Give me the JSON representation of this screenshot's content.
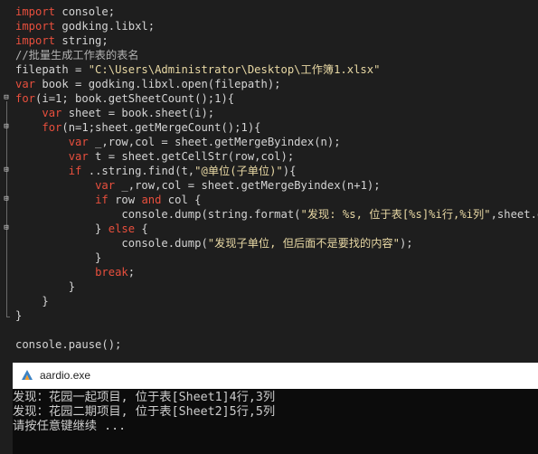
{
  "editor": {
    "lines": [
      [
        {
          "t": "import",
          "c": "kw"
        },
        {
          "t": " console;"
        }
      ],
      [
        {
          "t": "import",
          "c": "kw"
        },
        {
          "t": " godking.libxl;"
        }
      ],
      [
        {
          "t": "import",
          "c": "kw"
        },
        {
          "t": " string;"
        }
      ],
      [
        {
          "t": "//批量生成工作表的表名",
          "c": "cm"
        }
      ],
      [
        {
          "t": "filepath = "
        },
        {
          "t": "\"C:\\Users\\Administrator\\Desktop\\工作簿1.xlsx\"",
          "c": "st"
        }
      ],
      [
        {
          "t": "var",
          "c": "kw"
        },
        {
          "t": " book = godking.libxl.open(filepath);"
        }
      ],
      [
        {
          "t": "for",
          "c": "kw"
        },
        {
          "t": "(i=1; book.getSheetCount();1){"
        }
      ],
      [
        {
          "t": "    "
        },
        {
          "t": "var",
          "c": "kw"
        },
        {
          "t": " sheet = book.sheet(i);"
        }
      ],
      [
        {
          "t": "    "
        },
        {
          "t": "for",
          "c": "kw"
        },
        {
          "t": "(n=1;sheet.getMergeCount();1){"
        }
      ],
      [
        {
          "t": "        "
        },
        {
          "t": "var",
          "c": "kw"
        },
        {
          "t": " _,row,col = sheet.getMergeByindex(n);"
        }
      ],
      [
        {
          "t": "        "
        },
        {
          "t": "var",
          "c": "kw"
        },
        {
          "t": " t = sheet.getCellStr(row,col);"
        }
      ],
      [
        {
          "t": "        "
        },
        {
          "t": "if",
          "c": "kw"
        },
        {
          "t": " ..string.find(t,"
        },
        {
          "t": "\"@单位(子单位)\"",
          "c": "st"
        },
        {
          "t": "){"
        }
      ],
      [
        {
          "t": "            "
        },
        {
          "t": "var",
          "c": "kw"
        },
        {
          "t": " _,row,col = sheet.getMergeByindex(n+1);"
        }
      ],
      [
        {
          "t": "            "
        },
        {
          "t": "if",
          "c": "kw"
        },
        {
          "t": " row "
        },
        {
          "t": "and",
          "c": "kw"
        },
        {
          "t": " col {"
        }
      ],
      [
        {
          "t": "                console.dump(string.format("
        },
        {
          "t": "\"发现: %s, 位于表[%s]%i行,%i列\"",
          "c": "st"
        },
        {
          "t": ",sheet.getCellStr(row,col),sheet.name,row,col));"
        }
      ],
      [
        {
          "t": "            } "
        },
        {
          "t": "else",
          "c": "kw"
        },
        {
          "t": " {"
        }
      ],
      [
        {
          "t": "                console.dump("
        },
        {
          "t": "\"发现子单位, 但后面不是要找的内容\"",
          "c": "st"
        },
        {
          "t": ");"
        }
      ],
      [
        {
          "t": "            }"
        }
      ],
      [
        {
          "t": "            "
        },
        {
          "t": "break",
          "c": "kw"
        },
        {
          "t": ";"
        }
      ],
      [
        {
          "t": "        }"
        }
      ],
      [
        {
          "t": "    }"
        }
      ],
      [
        {
          "t": "}"
        }
      ],
      [
        {
          "t": ""
        }
      ],
      [
        {
          "t": "console.pause();"
        }
      ]
    ]
  },
  "console_window": {
    "title": "aardio.exe",
    "icon": "aardio-app-icon",
    "output": [
      "发现：花园一起项目, 位于表[Sheet1]4行,3列",
      "发现：花园二期项目, 位于表[Sheet2]5行,5列",
      "请按任意键继续 ..."
    ]
  },
  "colors": {
    "editor_background": "#1e1e1e",
    "keyword": "#e84f3d",
    "comment": "#b2b2b2",
    "string": "#e8d8a4",
    "text": "#d4d4d4",
    "console_background": "#0c0c0c",
    "console_text": "#cccccc"
  }
}
